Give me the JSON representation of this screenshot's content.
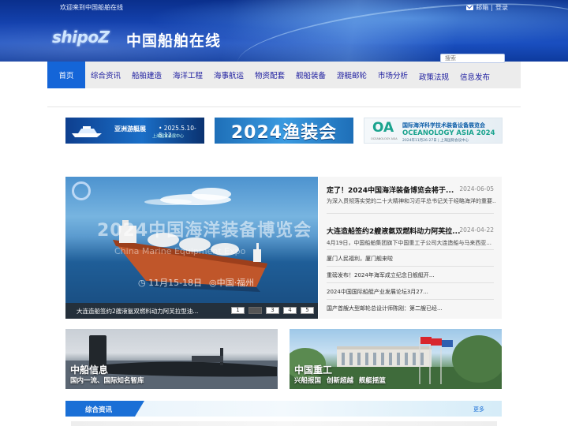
{
  "header": {
    "welcome": "欢迎来到中国船舶在线",
    "mail_label": "邮箱",
    "separator": "|",
    "login_label": "登录",
    "logo_en": "shipoZ",
    "site_title": "中国船舶在线",
    "search_placeholder": "搜索"
  },
  "nav": {
    "items": [
      {
        "label": "首页",
        "active": true
      },
      {
        "label": "综合资讯"
      },
      {
        "label": "船舶建造"
      },
      {
        "label": "海洋工程"
      },
      {
        "label": "海事航运"
      },
      {
        "label": "物资配套"
      },
      {
        "label": "舰船装备"
      },
      {
        "label": "游艇邮轮"
      },
      {
        "label": "市场分析"
      },
      {
        "label": "政策法规"
      },
      {
        "label": "信息发布"
      }
    ]
  },
  "ads": {
    "ad1": {
      "title": "亚洲游艇展",
      "date": "• 2025.5.10-5.12",
      "sub": "上海国家会展中心"
    },
    "ad2": {
      "text": "2024渔装会"
    },
    "ad3": {
      "logo": "OA",
      "cn": "国际海洋科学技术装备设备展览会",
      "en": "OCEANOLOGY ASIA 2024",
      "sub": "2024年11月26-27日 | 上海国际会议中心",
      "tiny": "OCEANOLOGY ASIA"
    }
  },
  "slider": {
    "watermark": "2024中国海洋装备博览会",
    "watermark_en": "China Marine Equipment Expo",
    "date_text": "◷ 11月15-18日",
    "location_text": "◎中国·福州",
    "caption": "大连造船签约2艘液氨双燃料动力阿芙拉型油...",
    "pages": [
      "1",
      "2",
      "3",
      "4",
      "5"
    ],
    "active_page": 2
  },
  "news": {
    "headline1": {
      "title": "定了！2024中国海洋装备博览会将于...",
      "date": "2024-06-05",
      "summary": "为深入贯彻落实党的二十大精神和习近平总书记关于经略海洋的重要..."
    },
    "headline2": {
      "title": "大连造船签约2艘液氨双燃料动力阿芙拉...",
      "date": "2024-04-22",
      "summary": "4月19日，中国船舶集团旗下中国重工子公司大连造船与马来西亚..."
    },
    "items": [
      "厦门人民福利，厦门舰来啦",
      "重磅发布！2024年海军成立纪念日舰艇开...",
      "2024中国国际船艇产业发展论坛3月27...",
      "国产首艘大型邮轮总设计师陈刚：第二艘已经..."
    ]
  },
  "cards": [
    {
      "title": "中船信息",
      "subtitle": "国内一流、国际知名智库"
    },
    {
      "title": "中国重工",
      "subtitle": "兴船报国  创新超越  舰艇摇篮"
    }
  ],
  "section": {
    "title": "综合资讯",
    "more": "更多"
  },
  "colors": {
    "header_blue": "#1543b0",
    "nav_active": "#1465d8",
    "nav_text": "#1a1a9e",
    "section_tab": "#1a6fd6"
  }
}
